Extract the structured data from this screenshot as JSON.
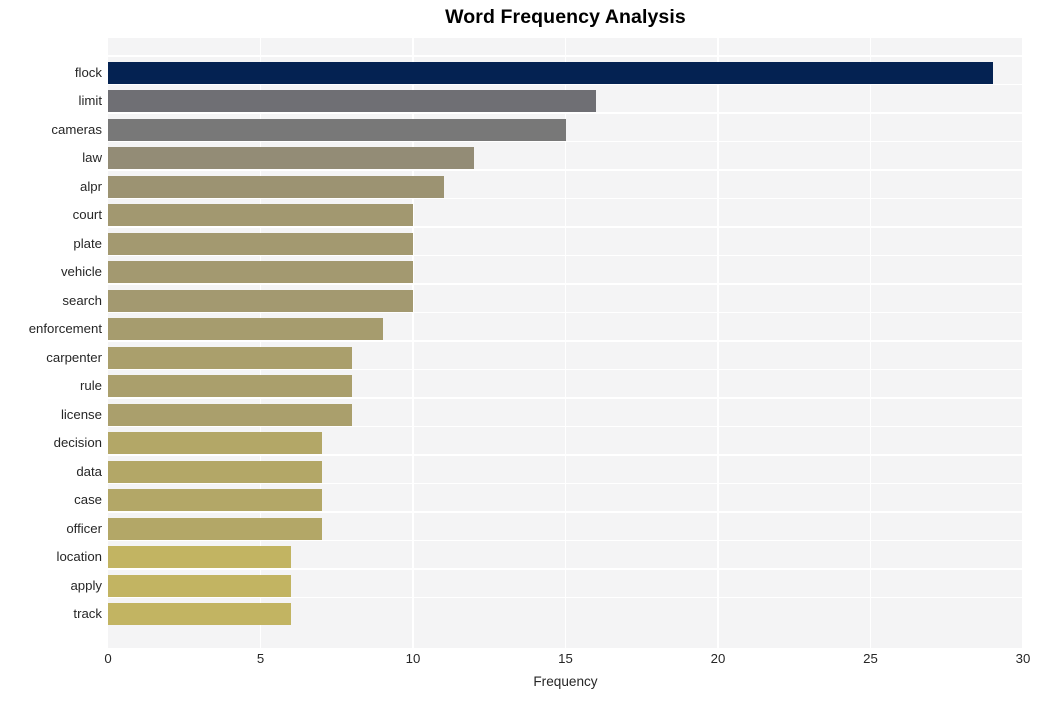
{
  "chart_data": {
    "type": "bar",
    "orientation": "horizontal",
    "title": "Word Frequency Analysis",
    "xlabel": "Frequency",
    "ylabel": "",
    "xlim": [
      0,
      30
    ],
    "ylim_categories": 20,
    "xticks": [
      0,
      5,
      10,
      15,
      20,
      25,
      30
    ],
    "xtick_labels": [
      "0",
      "5",
      "10",
      "15",
      "20",
      "25",
      "30"
    ],
    "grid": true,
    "grid_axis": "both",
    "legend": false,
    "categories": [
      "flock",
      "limit",
      "cameras",
      "law",
      "alpr",
      "court",
      "plate",
      "vehicle",
      "search",
      "enforcement",
      "carpenter",
      "rule",
      "license",
      "decision",
      "data",
      "case",
      "officer",
      "location",
      "apply",
      "track"
    ],
    "values": [
      29,
      16,
      15,
      12,
      11,
      10,
      10,
      10,
      10,
      9,
      8,
      8,
      8,
      7,
      7,
      7,
      7,
      6,
      6,
      6
    ],
    "bar_colors": [
      "#042252",
      "#6f6f74",
      "#787878",
      "#938c76",
      "#9c9372",
      "#a29870",
      "#a39970",
      "#a39970",
      "#a39970",
      "#a69c6e",
      "#aa9f6c",
      "#aa9f6c",
      "#aa9f6c",
      "#b3a767",
      "#b3a767",
      "#b3a767",
      "#b3a767",
      "#c2b462",
      "#c2b462",
      "#c2b462"
    ],
    "plot_background": "#f4f4f5",
    "grid_color": "#ffffff",
    "figure_background": "#ffffff",
    "text_color": "#262626"
  }
}
